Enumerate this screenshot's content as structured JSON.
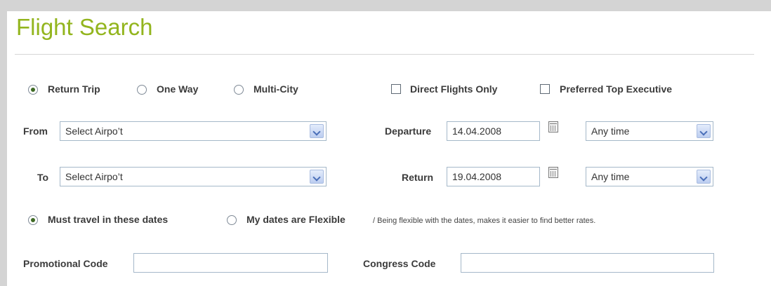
{
  "title": "Flight Search",
  "trip_type": {
    "options": [
      {
        "label": "Return Trip",
        "checked": true
      },
      {
        "label": "One Way",
        "checked": false
      },
      {
        "label": "Multi-City",
        "checked": false
      }
    ]
  },
  "filters": {
    "direct_label": "Direct Flights Only",
    "direct_checked": false,
    "preferred_label": "Preferred Top Executive",
    "preferred_checked": false
  },
  "from": {
    "label": "From",
    "value": "Select Airpo’t"
  },
  "to": {
    "label": "To",
    "value": "Select Airpo’t"
  },
  "departure": {
    "label": "Departure",
    "date": "14.04.2008",
    "time": "Any time"
  },
  "return": {
    "label": "Return",
    "date": "19.04.2008",
    "time": "Any time"
  },
  "date_flex": {
    "must_label": "Must travel in these dates",
    "must_checked": true,
    "flexible_label": "My dates are Flexible",
    "flexible_checked": false,
    "note": "/ Being flexible with the dates, makes it easier to find better rates."
  },
  "promo": {
    "label": "Promotional Code",
    "value": ""
  },
  "congress": {
    "label": "Congress Code",
    "value": ""
  },
  "colors": {
    "title": "#93b51e",
    "radio_dot": "#3e6a24"
  }
}
